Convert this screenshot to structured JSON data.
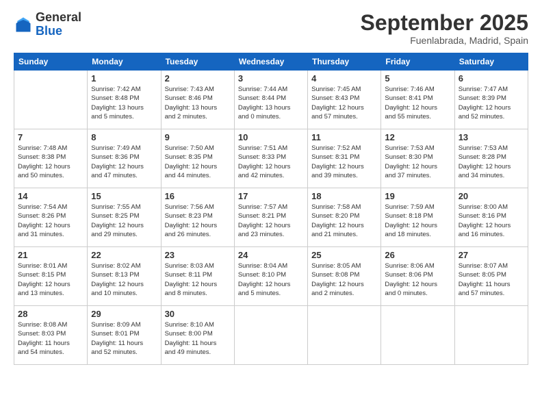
{
  "logo": {
    "general": "General",
    "blue": "Blue"
  },
  "header": {
    "month": "September 2025",
    "location": "Fuenlabrada, Madrid, Spain"
  },
  "days_of_week": [
    "Sunday",
    "Monday",
    "Tuesday",
    "Wednesday",
    "Thursday",
    "Friday",
    "Saturday"
  ],
  "weeks": [
    [
      {
        "day": "",
        "info": ""
      },
      {
        "day": "1",
        "info": "Sunrise: 7:42 AM\nSunset: 8:48 PM\nDaylight: 13 hours\nand 5 minutes."
      },
      {
        "day": "2",
        "info": "Sunrise: 7:43 AM\nSunset: 8:46 PM\nDaylight: 13 hours\nand 2 minutes."
      },
      {
        "day": "3",
        "info": "Sunrise: 7:44 AM\nSunset: 8:44 PM\nDaylight: 13 hours\nand 0 minutes."
      },
      {
        "day": "4",
        "info": "Sunrise: 7:45 AM\nSunset: 8:43 PM\nDaylight: 12 hours\nand 57 minutes."
      },
      {
        "day": "5",
        "info": "Sunrise: 7:46 AM\nSunset: 8:41 PM\nDaylight: 12 hours\nand 55 minutes."
      },
      {
        "day": "6",
        "info": "Sunrise: 7:47 AM\nSunset: 8:39 PM\nDaylight: 12 hours\nand 52 minutes."
      }
    ],
    [
      {
        "day": "7",
        "info": "Sunrise: 7:48 AM\nSunset: 8:38 PM\nDaylight: 12 hours\nand 50 minutes."
      },
      {
        "day": "8",
        "info": "Sunrise: 7:49 AM\nSunset: 8:36 PM\nDaylight: 12 hours\nand 47 minutes."
      },
      {
        "day": "9",
        "info": "Sunrise: 7:50 AM\nSunset: 8:35 PM\nDaylight: 12 hours\nand 44 minutes."
      },
      {
        "day": "10",
        "info": "Sunrise: 7:51 AM\nSunset: 8:33 PM\nDaylight: 12 hours\nand 42 minutes."
      },
      {
        "day": "11",
        "info": "Sunrise: 7:52 AM\nSunset: 8:31 PM\nDaylight: 12 hours\nand 39 minutes."
      },
      {
        "day": "12",
        "info": "Sunrise: 7:53 AM\nSunset: 8:30 PM\nDaylight: 12 hours\nand 37 minutes."
      },
      {
        "day": "13",
        "info": "Sunrise: 7:53 AM\nSunset: 8:28 PM\nDaylight: 12 hours\nand 34 minutes."
      }
    ],
    [
      {
        "day": "14",
        "info": "Sunrise: 7:54 AM\nSunset: 8:26 PM\nDaylight: 12 hours\nand 31 minutes."
      },
      {
        "day": "15",
        "info": "Sunrise: 7:55 AM\nSunset: 8:25 PM\nDaylight: 12 hours\nand 29 minutes."
      },
      {
        "day": "16",
        "info": "Sunrise: 7:56 AM\nSunset: 8:23 PM\nDaylight: 12 hours\nand 26 minutes."
      },
      {
        "day": "17",
        "info": "Sunrise: 7:57 AM\nSunset: 8:21 PM\nDaylight: 12 hours\nand 23 minutes."
      },
      {
        "day": "18",
        "info": "Sunrise: 7:58 AM\nSunset: 8:20 PM\nDaylight: 12 hours\nand 21 minutes."
      },
      {
        "day": "19",
        "info": "Sunrise: 7:59 AM\nSunset: 8:18 PM\nDaylight: 12 hours\nand 18 minutes."
      },
      {
        "day": "20",
        "info": "Sunrise: 8:00 AM\nSunset: 8:16 PM\nDaylight: 12 hours\nand 16 minutes."
      }
    ],
    [
      {
        "day": "21",
        "info": "Sunrise: 8:01 AM\nSunset: 8:15 PM\nDaylight: 12 hours\nand 13 minutes."
      },
      {
        "day": "22",
        "info": "Sunrise: 8:02 AM\nSunset: 8:13 PM\nDaylight: 12 hours\nand 10 minutes."
      },
      {
        "day": "23",
        "info": "Sunrise: 8:03 AM\nSunset: 8:11 PM\nDaylight: 12 hours\nand 8 minutes."
      },
      {
        "day": "24",
        "info": "Sunrise: 8:04 AM\nSunset: 8:10 PM\nDaylight: 12 hours\nand 5 minutes."
      },
      {
        "day": "25",
        "info": "Sunrise: 8:05 AM\nSunset: 8:08 PM\nDaylight: 12 hours\nand 2 minutes."
      },
      {
        "day": "26",
        "info": "Sunrise: 8:06 AM\nSunset: 8:06 PM\nDaylight: 12 hours\nand 0 minutes."
      },
      {
        "day": "27",
        "info": "Sunrise: 8:07 AM\nSunset: 8:05 PM\nDaylight: 11 hours\nand 57 minutes."
      }
    ],
    [
      {
        "day": "28",
        "info": "Sunrise: 8:08 AM\nSunset: 8:03 PM\nDaylight: 11 hours\nand 54 minutes."
      },
      {
        "day": "29",
        "info": "Sunrise: 8:09 AM\nSunset: 8:01 PM\nDaylight: 11 hours\nand 52 minutes."
      },
      {
        "day": "30",
        "info": "Sunrise: 8:10 AM\nSunset: 8:00 PM\nDaylight: 11 hours\nand 49 minutes."
      },
      {
        "day": "",
        "info": ""
      },
      {
        "day": "",
        "info": ""
      },
      {
        "day": "",
        "info": ""
      },
      {
        "day": "",
        "info": ""
      }
    ]
  ]
}
